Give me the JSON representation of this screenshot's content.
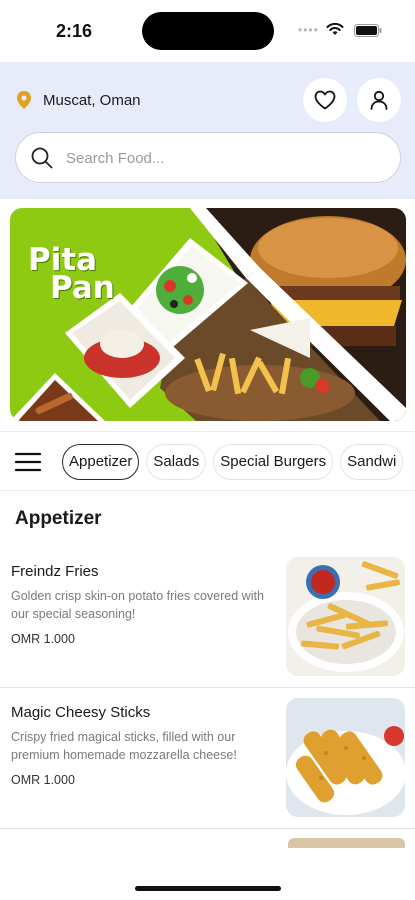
{
  "status": {
    "time": "2:16"
  },
  "header": {
    "location": "Muscat, Oman",
    "search_placeholder": "Search Food..."
  },
  "banner": {
    "brand_line1": "Pita",
    "brand_line2": "Pan"
  },
  "categories": [
    {
      "label": "Appetizer",
      "active": true
    },
    {
      "label": "Salads",
      "active": false
    },
    {
      "label": "Special Burgers",
      "active": false
    },
    {
      "label": "Sandwi",
      "active": false
    }
  ],
  "section": {
    "title": "Appetizer"
  },
  "items": [
    {
      "name": "Freindz Fries",
      "description": "Golden crisp skin-on potato fries covered with our special seasoning!",
      "price": "OMR 1.000"
    },
    {
      "name": "Magic Cheesy Sticks",
      "description": "Crispy fried magical sticks, filled with our premium homemade mozzarella cheese!",
      "price": "OMR 1.000"
    }
  ],
  "colors": {
    "header_bg": "#e8ebfa",
    "banner_green": "#8fca12",
    "pin": "#e0a020"
  }
}
